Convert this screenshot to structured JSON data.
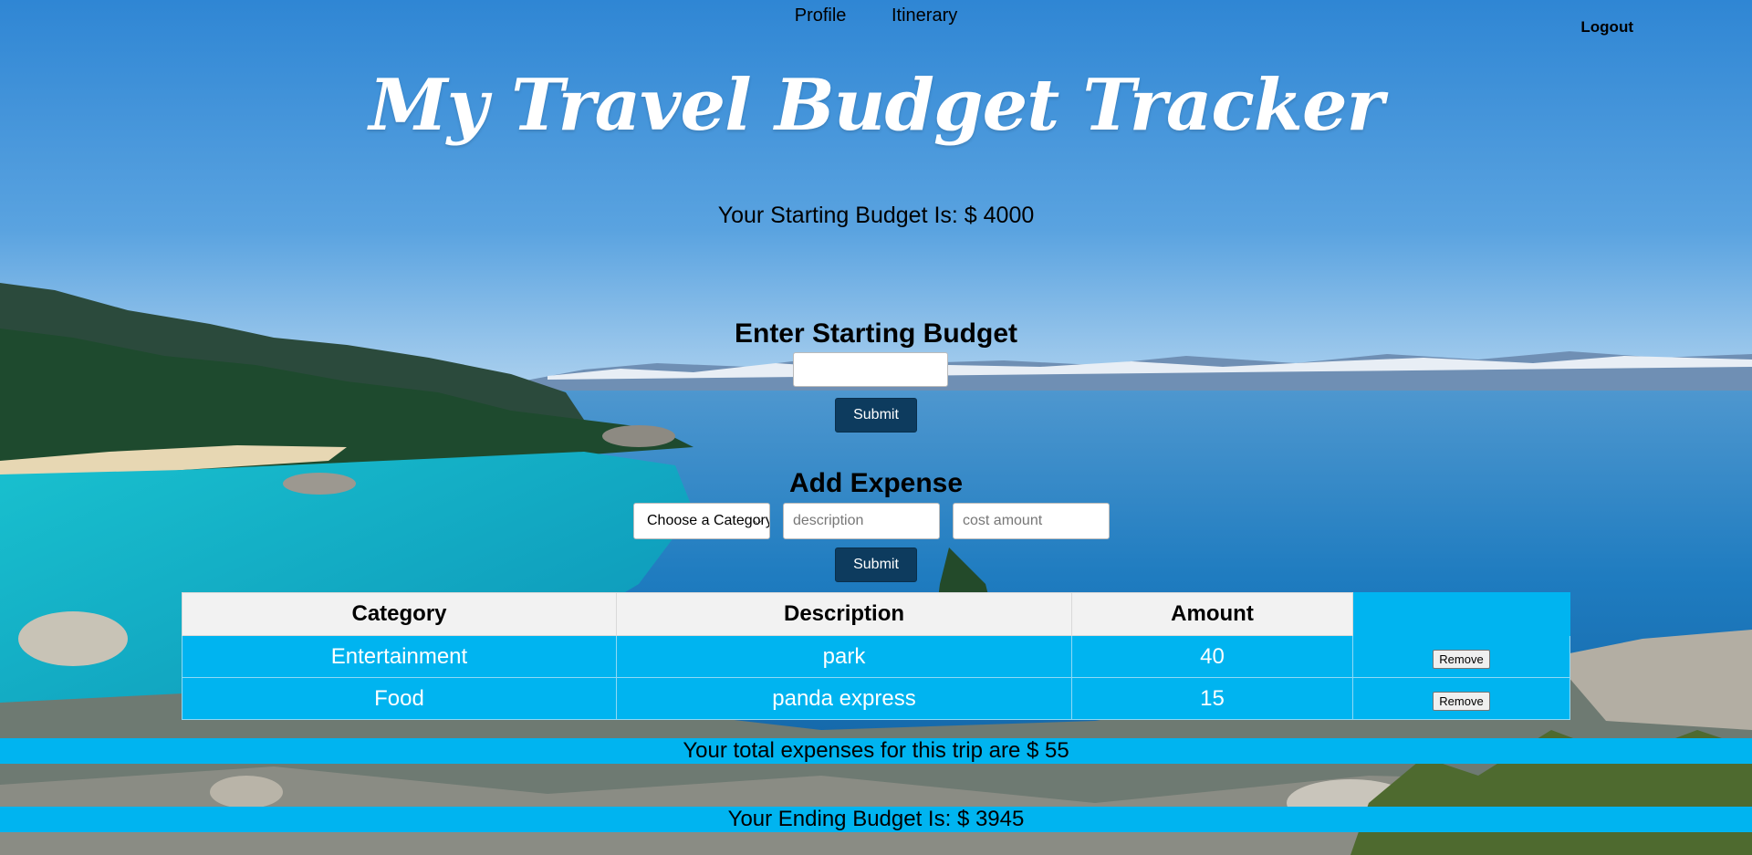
{
  "nav": {
    "profile": "Profile",
    "itinerary": "Itinerary",
    "logout": "Logout"
  },
  "header": {
    "title": "My Travel Budget Tracker",
    "starting_budget_text": "Your Starting Budget Is: $ 4000"
  },
  "budget_form": {
    "heading": "Enter Starting Budget",
    "input_value": "",
    "submit_label": "Submit"
  },
  "expense_form": {
    "heading": "Add Expense",
    "category_selected": "Choose a Category",
    "description_placeholder": "description",
    "cost_placeholder": "cost amount",
    "submit_label": "Submit"
  },
  "table": {
    "headers": [
      "Category",
      "Description",
      "Amount",
      ""
    ],
    "rows": [
      {
        "category": "Entertainment",
        "description": "park",
        "amount": "40",
        "action": "Remove"
      },
      {
        "category": "Food",
        "description": "panda express",
        "amount": "15",
        "action": "Remove"
      }
    ]
  },
  "summary": {
    "total_expenses": "Your total expenses for this trip are $ 55",
    "ending_budget": "Your Ending Budget Is: $ 3945"
  },
  "colors": {
    "accent": "#00b4f0",
    "button": "#0d3b5e",
    "title": "#ffffff"
  }
}
